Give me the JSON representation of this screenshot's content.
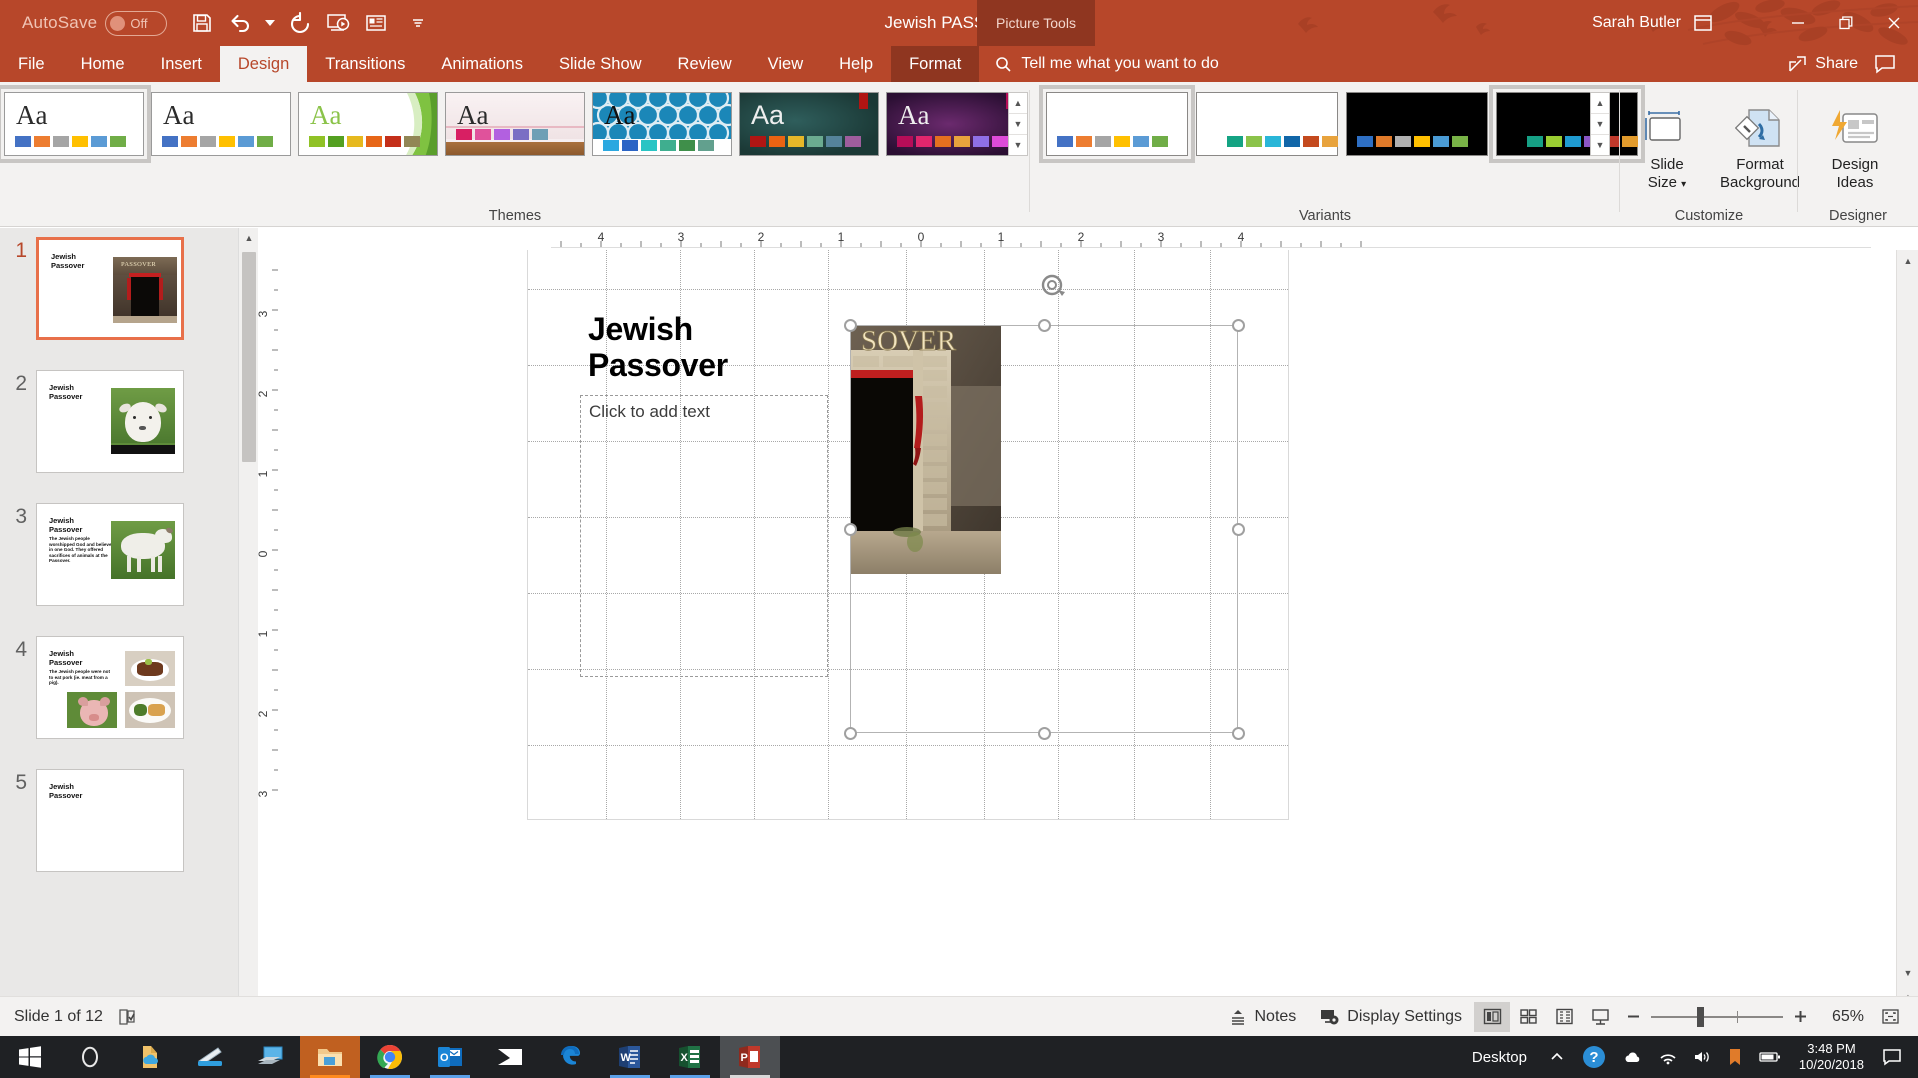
{
  "titlebar": {
    "autosave_label": "AutoSave",
    "autosave_state": "Off",
    "doc_title": "Jewish PASSOVER",
    "context_tab_group": "Picture Tools",
    "user_name": "Sarah Butler",
    "accent_color": "#b7472a",
    "qat": [
      {
        "name": "save-icon",
        "tip": "Save"
      },
      {
        "name": "undo-icon",
        "tip": "Undo"
      },
      {
        "name": "undo-dropdown-icon",
        "tip": "Undo options"
      },
      {
        "name": "redo-icon",
        "tip": "Redo"
      },
      {
        "name": "start-from-beginning-icon",
        "tip": "Start From Beginning"
      },
      {
        "name": "new-slide-icon",
        "tip": "New Slide"
      },
      {
        "name": "customize-qat-icon",
        "tip": "Customize Quick Access Toolbar"
      }
    ],
    "window_controls": [
      {
        "name": "ribbon-display-options-icon",
        "glyph": "ribbon"
      },
      {
        "name": "minimize-button",
        "glyph": "minimize"
      },
      {
        "name": "restore-button",
        "glyph": "restore"
      },
      {
        "name": "close-button",
        "glyph": "close"
      }
    ]
  },
  "ribbon_tabs": {
    "items": [
      {
        "label": "File",
        "active": false
      },
      {
        "label": "Home",
        "active": false
      },
      {
        "label": "Insert",
        "active": false
      },
      {
        "label": "Design",
        "active": true
      },
      {
        "label": "Transitions",
        "active": false
      },
      {
        "label": "Animations",
        "active": false
      },
      {
        "label": "Slide Show",
        "active": false
      },
      {
        "label": "Review",
        "active": false
      },
      {
        "label": "View",
        "active": false
      },
      {
        "label": "Help",
        "active": false
      },
      {
        "label": "Format",
        "active": false,
        "contextual": true
      }
    ],
    "tell_me_placeholder": "Tell me what you want to do",
    "share_label": "Share",
    "comments_icon": "comment-icon"
  },
  "ribbon": {
    "groups": [
      {
        "label": "Themes"
      },
      {
        "label": "Variants"
      },
      {
        "label": "Customize"
      },
      {
        "label": "Designer"
      }
    ],
    "themes": [
      {
        "name": "office-theme",
        "selected": true,
        "style": "plain",
        "swatches": [
          "#4472c4",
          "#ed7d31",
          "#a5a5a5",
          "#ffc000",
          "#5b9bd5",
          "#70ad47"
        ]
      },
      {
        "name": "plain-white-theme",
        "selected": false,
        "style": "plain",
        "swatches": [
          "#4472c4",
          "#ed7d31",
          "#a5a5a5",
          "#ffc000",
          "#5b9bd5",
          "#70ad47"
        ]
      },
      {
        "name": "facet-green-theme",
        "selected": false,
        "style": "green",
        "swatches": [
          "#90c226",
          "#54a021",
          "#e6b91e",
          "#e76618",
          "#c42f1a",
          "#918655"
        ]
      },
      {
        "name": "gallery-wood-theme",
        "selected": false,
        "style": "wood",
        "swatches": [
          "#d34817",
          "#9b2d1f",
          "#a28e6a",
          "#956251",
          "#918485",
          "#855d5d"
        ]
      },
      {
        "name": "circuit-blue-theme",
        "selected": false,
        "style": "pattern",
        "swatches": [
          "#2ba8e0",
          "#2b64c5",
          "#29c4c4",
          "#3fae8f",
          "#3f8f4a",
          "#62a08e"
        ]
      },
      {
        "name": "ion-boardroom-theme",
        "selected": false,
        "style": "dark-teal",
        "swatches": [
          "#b01513",
          "#ea6312",
          "#e6b729",
          "#6bab90",
          "#55839a",
          "#9e5d9d"
        ]
      },
      {
        "name": "quotable-purple-theme",
        "selected": false,
        "style": "purple",
        "swatches": [
          "#b60d58",
          "#e1266d",
          "#e4701f",
          "#e8a33d",
          "#8f6fe6",
          "#dd4bd9"
        ]
      }
    ],
    "variants": [
      {
        "name": "variant-white-1",
        "selected": true,
        "bg": "light",
        "swatches": [
          "#4472c4",
          "#ed7d31",
          "#a5a5a5",
          "#ffc000",
          "#5b9bd5",
          "#70ad47"
        ]
      },
      {
        "name": "variant-white-2",
        "selected": false,
        "bg": "light",
        "swatches": [
          "#14a383",
          "#8bc34a",
          "#29b6d8",
          "#1166a8",
          "#c44a1e",
          "#e8a33d"
        ]
      },
      {
        "name": "variant-black-1",
        "selected": false,
        "bg": "dark",
        "swatches": [
          "#2e6fc4",
          "#e07a2a",
          "#b0b0b0",
          "#ffc000",
          "#4a9bd5",
          "#79b347"
        ]
      },
      {
        "name": "variant-black-2",
        "selected": false,
        "bg": "dark",
        "swatches": [
          "#16a085",
          "#9acd32",
          "#1f9bd1",
          "#8a56c6",
          "#c0392b",
          "#e29b2c"
        ]
      }
    ],
    "customize_buttons": [
      {
        "name": "slide-size-button",
        "line1": "Slide",
        "line2": "Size",
        "dropdown": true
      },
      {
        "name": "format-background-button",
        "line1": "Format",
        "line2": "Background",
        "dropdown": false
      }
    ],
    "designer_buttons": [
      {
        "name": "design-ideas-button",
        "line1": "Design",
        "line2": "Ideas",
        "dropdown": false
      }
    ],
    "gallery_scroll": [
      "scroll-up-icon",
      "scroll-down-icon",
      "more-themes-icon"
    ],
    "variant_scroll": [
      "scroll-up-icon",
      "scroll-down-icon",
      "more-variants-icon"
    ]
  },
  "slide_panel": {
    "slides": [
      {
        "number": "1",
        "selected": true,
        "title": "Jewish\nPassover",
        "body": "",
        "image": "passover-doorway"
      },
      {
        "number": "2",
        "selected": false,
        "title": "Jewish\nPassover",
        "body": "",
        "image": "lamb-face"
      },
      {
        "number": "3",
        "selected": false,
        "title": "Jewish\nPassover",
        "body": "The Jewish people worshipped God and believed in one God. They offered sacrifices of animals at the Passover.",
        "image": "sheep-standing"
      },
      {
        "number": "4",
        "selected": false,
        "title": "Jewish\nPassover",
        "body": "The Jewish people were not to eat pork (ie. meat from a pig).",
        "image": "food-collage"
      },
      {
        "number": "5",
        "selected": false,
        "title": "Jewish\nPassover",
        "body": "",
        "image": "blank"
      }
    ]
  },
  "canvas": {
    "title_text": "Jewish\nPassover",
    "body_placeholder": "Click to add text",
    "selected_object": "passover-door-picture",
    "picture_caption_text": "SOVER",
    "ruler_h_labels": [
      "4",
      "3",
      "2",
      "1",
      "0",
      "1",
      "2",
      "3",
      "4"
    ],
    "ruler_v_labels": [
      "3",
      "2",
      "1",
      "0",
      "1",
      "2",
      "3"
    ]
  },
  "statusbar": {
    "slide_indicator": "Slide 1 of 12",
    "accessibility_icon": "accessibility-checker-icon",
    "notes_label": "Notes",
    "display_settings_label": "Display Settings",
    "views": [
      {
        "name": "normal-view-button",
        "active": true
      },
      {
        "name": "slide-sorter-view-button",
        "active": false
      },
      {
        "name": "reading-view-button",
        "active": false
      },
      {
        "name": "slide-show-button",
        "active": false
      }
    ],
    "zoom_out_icon": "zoom-out-icon",
    "zoom_in_icon": "zoom-in-icon",
    "zoom_level": "65%",
    "fit_slide_icon": "fit-slide-to-window-icon"
  },
  "taskbar": {
    "items": [
      {
        "name": "start-button",
        "icon": "windows-logo"
      },
      {
        "name": "cortana-search",
        "icon": "cortana-circle"
      },
      {
        "name": "onedrive-taskbar",
        "icon": "onedrive-folder"
      },
      {
        "name": "scanner-app",
        "icon": "scanner"
      },
      {
        "name": "remote-desktop-app",
        "icon": "remote-desktop"
      },
      {
        "name": "file-explorer",
        "icon": "folder",
        "state": "active-orange"
      },
      {
        "name": "google-chrome",
        "icon": "chrome",
        "state": "running"
      },
      {
        "name": "outlook",
        "icon": "outlook",
        "state": "running"
      },
      {
        "name": "mail-app",
        "icon": "mail"
      },
      {
        "name": "microsoft-edge",
        "icon": "edge"
      },
      {
        "name": "word",
        "icon": "word",
        "state": "running"
      },
      {
        "name": "excel",
        "icon": "excel",
        "state": "running"
      },
      {
        "name": "powerpoint",
        "icon": "powerpoint",
        "state": "active-grey"
      }
    ],
    "desktop_label": "Desktop",
    "tray": [
      {
        "name": "show-hidden-icons",
        "icon": "chevron-up"
      },
      {
        "name": "help-icon",
        "icon": "question-circle"
      },
      {
        "name": "onedrive-tray-icon",
        "icon": "cloud"
      },
      {
        "name": "network-icon",
        "icon": "network"
      },
      {
        "name": "volume-icon",
        "icon": "speaker"
      },
      {
        "name": "app-tray-icon",
        "icon": "orange-marker"
      },
      {
        "name": "battery-icon",
        "icon": "battery"
      }
    ],
    "clock_time": "3:48 PM",
    "clock_date": "10/20/2018",
    "action_center_icon": "notification-icon"
  }
}
